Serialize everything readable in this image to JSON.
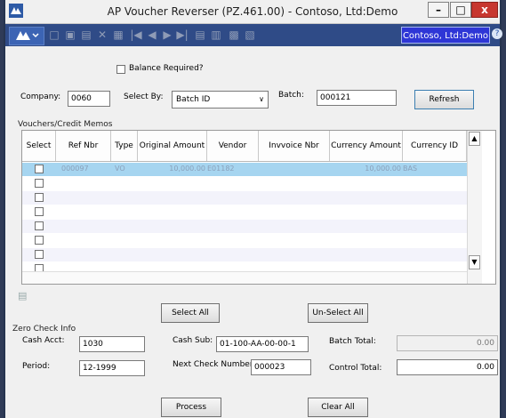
{
  "window": {
    "title": "AP Voucher Reverser (PZ.461.00) - Contoso, Ltd:Demo",
    "minimize": "–",
    "maximize": "□",
    "close": "x"
  },
  "toolbar": {
    "company_button": "Contoso, Ltd:Demo",
    "help": "?"
  },
  "filters": {
    "balance_required_label": "Balance Required?",
    "company_label": "Company:",
    "company_value": "0060",
    "select_by_label": "Select By:",
    "select_by_value": "Batch ID",
    "batch_label": "Batch:",
    "batch_value": "000121",
    "refresh_label": "Refresh"
  },
  "grid": {
    "section_label": "Vouchers/Credit Memos",
    "columns": [
      "Select",
      "Ref Nbr",
      "Type",
      "Original Amount",
      "Vendor",
      "Invvoice Nbr",
      "Currency Amount",
      "Currency ID"
    ],
    "rows": [
      {
        "ref_nbr": "000097",
        "type": "VO",
        "original_amount": "10,000.00",
        "vendor": "E01182",
        "invoice_nbr": "",
        "currency_amount": "10,000.00",
        "currency_id": "BAS"
      }
    ],
    "empty_rows": 7
  },
  "actions": {
    "select_all": "Select All",
    "unselect_all": "Un-Select All",
    "process": "Process",
    "clear_all": "Clear All"
  },
  "zero_check": {
    "section_label": "Zero Check Info",
    "cash_acct_label": "Cash Acct:",
    "cash_acct_value": "1030",
    "cash_sub_label": "Cash Sub:",
    "cash_sub_value": "01-100-AA-00-00-1",
    "batch_total_label": "Batch Total:",
    "batch_total_value": "0.00",
    "period_label": "Period:",
    "period_value": "12-1999",
    "next_check_label": "Next Check Number:",
    "next_check_value": "000023",
    "control_total_label": "Control Total:",
    "control_total_value": "0.00"
  }
}
